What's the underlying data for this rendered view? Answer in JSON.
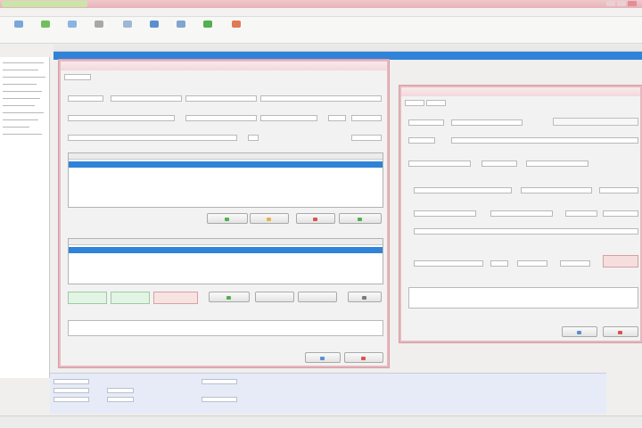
{
  "window": {
    "title": "",
    "tab": ""
  },
  "menu": {
    "items": [
      "",
      "",
      "",
      "",
      "",
      "",
      "",
      ""
    ]
  },
  "toolbar": {
    "buttons": [
      "",
      "",
      "",
      "",
      "",
      "",
      "",
      "",
      ""
    ]
  },
  "colors": {
    "accent": "#2f83d8",
    "title_pink": "#e6b3b8",
    "green": "#53b04e",
    "red": "#d9534f"
  },
  "dialog_left": {
    "title": "",
    "section_label": "",
    "buttons": [
      "",
      "",
      "",
      ""
    ],
    "bottom_buttons": [
      "",
      "",
      ""
    ],
    "status_boxes": [
      "",
      "",
      ""
    ],
    "notes_label": "",
    "ok_label": "",
    "cancel_label": ""
  },
  "dialog_right": {
    "title": "",
    "radio_a": "",
    "radio_b": "",
    "checkbox": "",
    "notes_label": "",
    "ok_label": "",
    "cancel_label": ""
  },
  "bottom_panel": {
    "rows": [
      "",
      "",
      "",
      ""
    ]
  },
  "status": {
    "text": ""
  }
}
